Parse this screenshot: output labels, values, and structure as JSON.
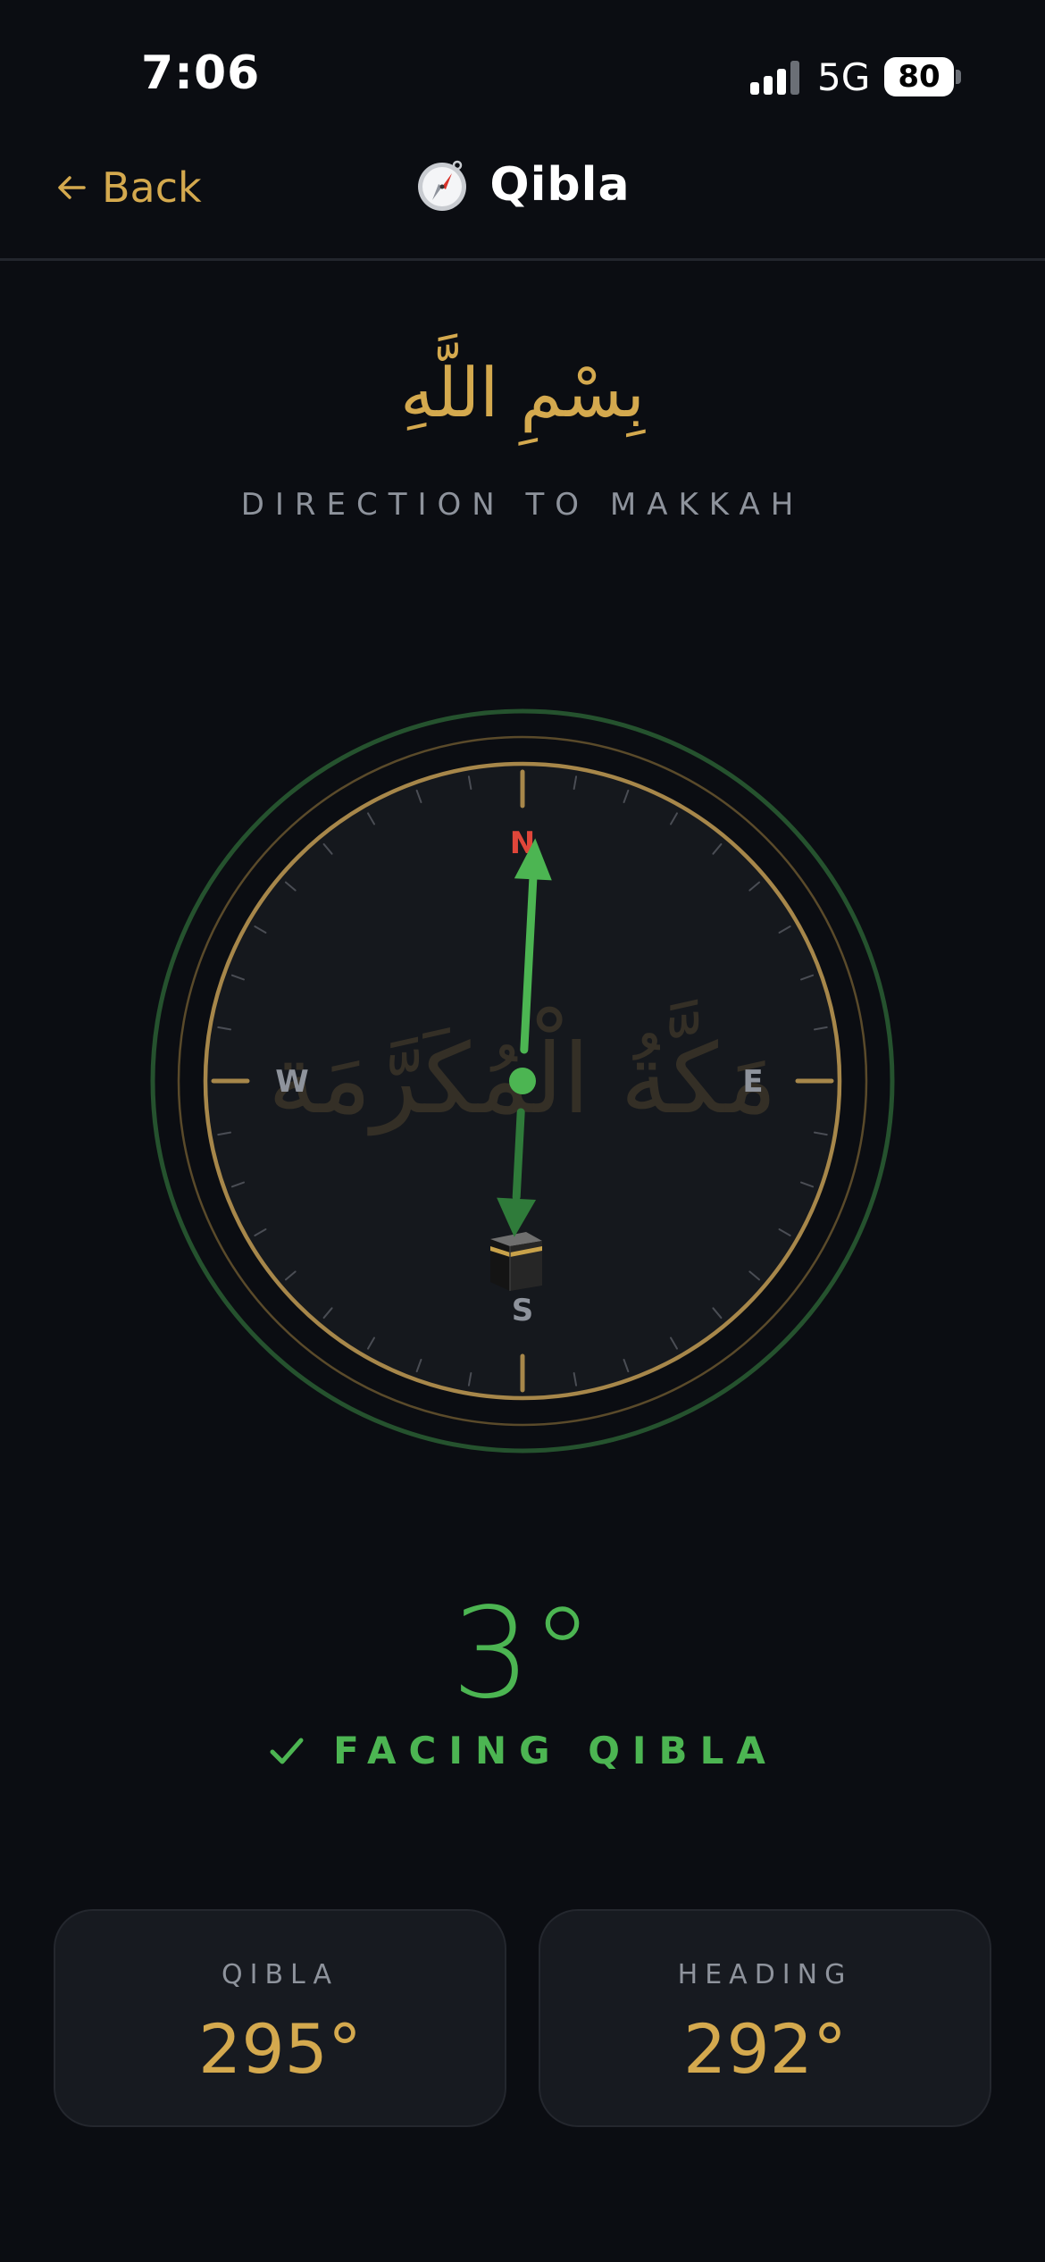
{
  "status_bar": {
    "time": "7:06",
    "network": "5G",
    "battery": "80"
  },
  "header": {
    "back_label": "Back",
    "title": "Qibla",
    "title_icon": "compass-icon"
  },
  "intro": {
    "arabic": "بِسْمِ اللَّهِ",
    "subtitle": "DIRECTION TO MAKKAH"
  },
  "compass": {
    "north": "N",
    "south": "S",
    "east": "E",
    "west": "W",
    "watermark": "مَكَّةُ الْمُكَرَّمَة",
    "qibla_bearing_deg": 295,
    "heading_deg": 292,
    "needle_offset_deg": 3,
    "kaaba_icon": "kaaba-icon"
  },
  "readout": {
    "degree": "3°",
    "status": "FACING QIBLA"
  },
  "cards": {
    "qibla_label": "QIBLA",
    "qibla_value": "295°",
    "heading_label": "HEADING",
    "heading_value": "292°"
  },
  "colors": {
    "accent": "#d4a94e",
    "success": "#4cb552",
    "north": "#e0463a",
    "background": "#0b0d12"
  }
}
